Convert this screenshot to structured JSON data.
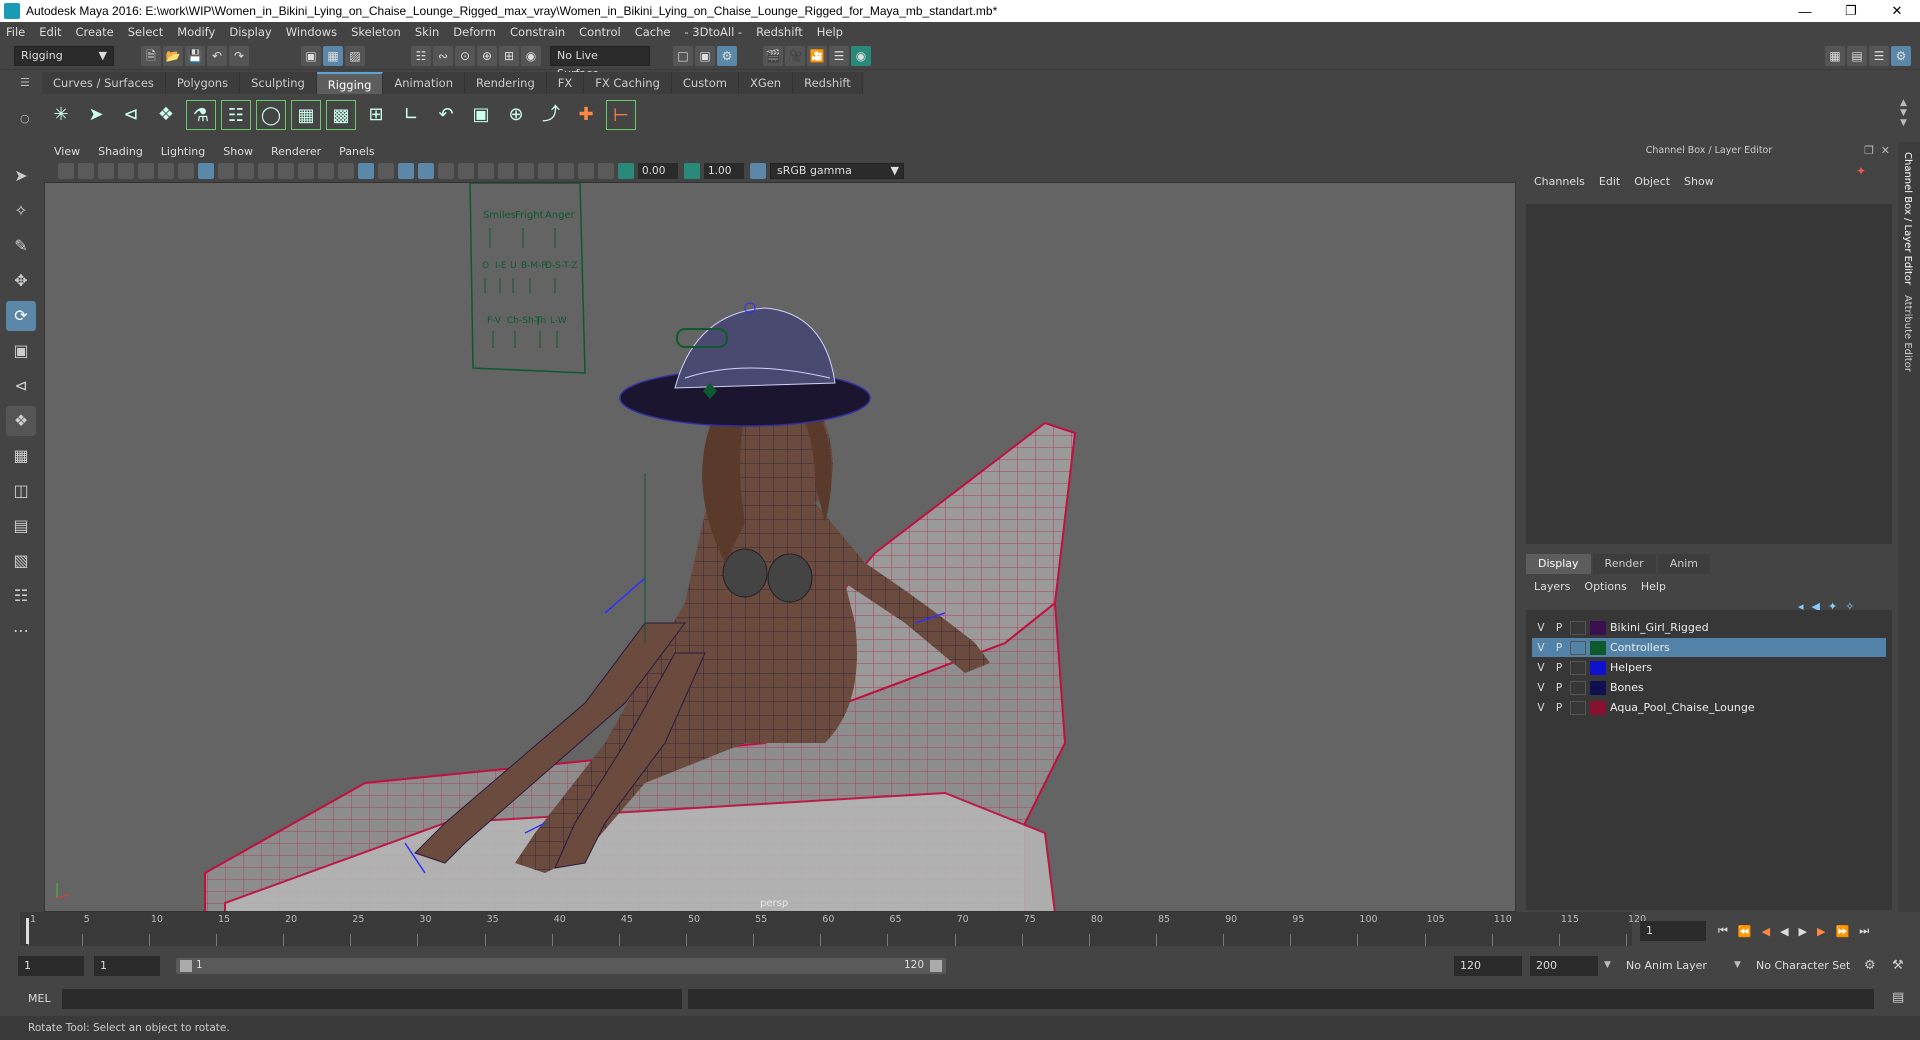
{
  "title": "Autodesk Maya 2016: E:\\work\\WIP\\Women_in_Bikini_Lying_on_Chaise_Lounge_Rigged_max_vray\\Women_in_Bikini_Lying_on_Chaise_Lounge_Rigged_for_Maya_mb_standart.mb*",
  "menu": [
    "File",
    "Edit",
    "Create",
    "Select",
    "Modify",
    "Display",
    "Windows",
    "Skeleton",
    "Skin",
    "Deform",
    "Constrain",
    "Control",
    "Cache",
    "- 3DtoAll -",
    "Redshift",
    "Help"
  ],
  "status": {
    "mode": "Rigging",
    "live_surface": "No Live Surface"
  },
  "shelf_tabs": [
    "Curves / Surfaces",
    "Polygons",
    "Sculpting",
    "Rigging",
    "Animation",
    "Rendering",
    "FX",
    "FX Caching",
    "Custom",
    "XGen",
    "Redshift"
  ],
  "shelf_active": "Rigging",
  "panel_menu": [
    "View",
    "Shading",
    "Lighting",
    "Show",
    "Renderer",
    "Panels"
  ],
  "panel_values": {
    "near": "0.00",
    "far": "1.00",
    "color_space": "sRGB gamma"
  },
  "viewport": {
    "camera": "persp",
    "face_labels": [
      "Smiles",
      "Fright",
      "Anger",
      "O",
      "I-E",
      "U",
      "B-M-P",
      "D-S-T-Z",
      "F-V",
      "Ch-Sh-J",
      "Th",
      "L-W"
    ]
  },
  "channel_box": {
    "title": "Channel Box / Layer Editor",
    "menu": [
      "Channels",
      "Edit",
      "Object",
      "Show"
    ],
    "tabs": [
      "Display",
      "Render",
      "Anim"
    ],
    "active_tab": "Display",
    "layer_menu": [
      "Layers",
      "Options",
      "Help"
    ],
    "layers": [
      {
        "v": "V",
        "p": "P",
        "name": "Bikini_Girl_Rigged",
        "color": "#3a1050"
      },
      {
        "v": "V",
        "p": "P",
        "name": "Controllers",
        "color": "#0e5a2e"
      },
      {
        "v": "V",
        "p": "P",
        "name": "Helpers",
        "color": "#1010d0"
      },
      {
        "v": "V",
        "p": "P",
        "name": "Bones",
        "color": "#101050"
      },
      {
        "v": "V",
        "p": "P",
        "name": "Aqua_Pool_Chaise_Lounge",
        "color": "#8a1030"
      }
    ],
    "selected_layer": 1
  },
  "side_tabs": [
    "Channel Box / Layer Editor",
    "Attribute Editor"
  ],
  "timeline": {
    "ticks": [
      "1",
      "5",
      "10",
      "15",
      "20",
      "25",
      "30",
      "35",
      "40",
      "45",
      "50",
      "55",
      "60",
      "65",
      "70",
      "75",
      "80",
      "85",
      "90",
      "95",
      "100",
      "105",
      "110",
      "115",
      "120"
    ],
    "current_frame": "1"
  },
  "range": {
    "start": "1",
    "range_start": "1",
    "slider_start": "1",
    "slider_end": "120",
    "range_end": "120",
    "end": "200",
    "anim_layer": "No Anim Layer",
    "character_set": "No Character Set"
  },
  "mel_label": "MEL",
  "help_line": "Rotate Tool: Select an object to rotate."
}
